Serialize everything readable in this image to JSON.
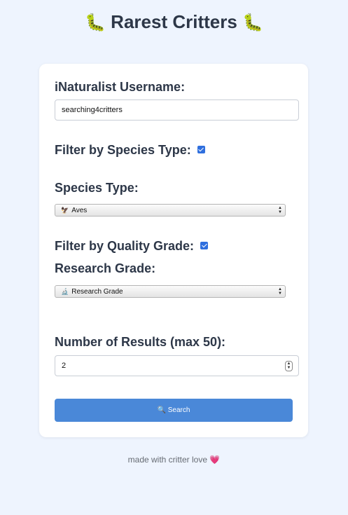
{
  "header": {
    "title": "Rarest Critters",
    "left_emoji": "🐛",
    "right_emoji": "🐛"
  },
  "form": {
    "username_label": "iNaturalist Username:",
    "username_value": "searching4critters",
    "filter_species_label": "Filter by Species Type:",
    "filter_species_checked": true,
    "species_type_label": "Species Type:",
    "species_type_icon": "🦅",
    "species_type_value": "Aves",
    "filter_quality_label": "Filter by Quality Grade:",
    "filter_quality_checked": true,
    "research_grade_label": "Research Grade:",
    "research_grade_icon": "🔬",
    "research_grade_value": "Research Grade",
    "num_results_label": "Number of Results (max 50):",
    "num_results_value": "2",
    "search_icon": "🔍",
    "search_label": "Search"
  },
  "footer": {
    "text": "made with critter love",
    "emoji": "💗"
  },
  "colors": {
    "background": "#eef4fe",
    "card": "#ffffff",
    "button": "#4a88d8",
    "checkbox": "#2f6fde",
    "text": "#2d3748"
  }
}
